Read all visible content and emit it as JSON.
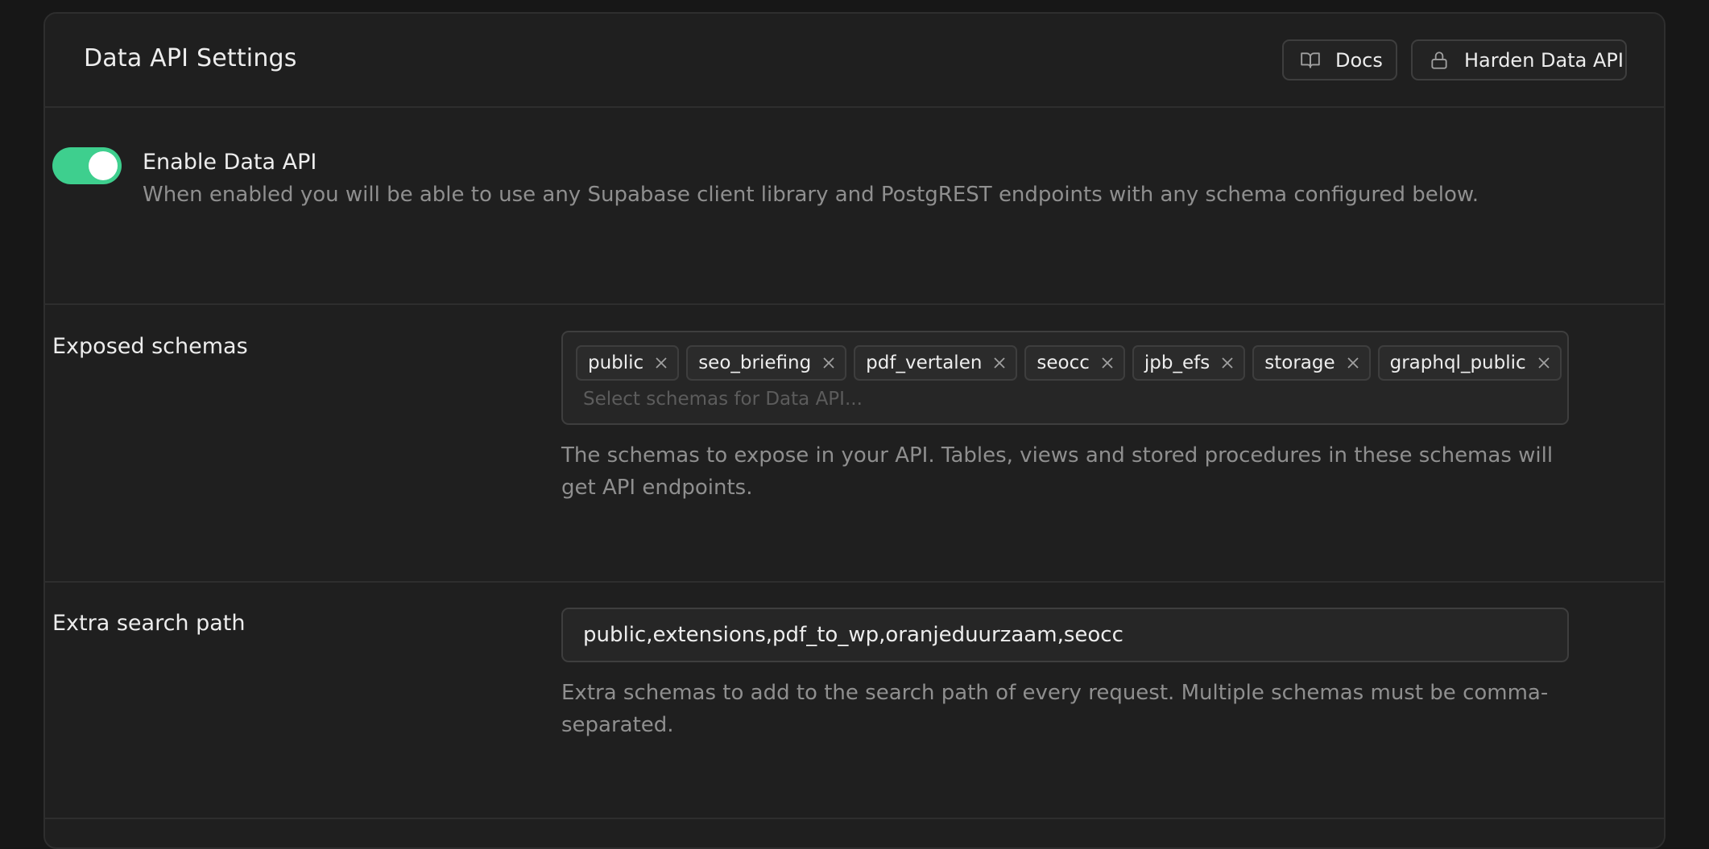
{
  "header": {
    "title": "Data API Settings",
    "docs_label": "Docs",
    "harden_label": "Harden Data API"
  },
  "enable": {
    "title": "Enable Data API",
    "description": "When enabled you will be able to use any Supabase client library and PostgREST endpoints with any schema configured below.",
    "enabled": true
  },
  "exposed_schemas": {
    "label": "Exposed schemas",
    "tags": [
      "public",
      "seo_briefing",
      "pdf_vertalen",
      "seocc",
      "jpb_efs",
      "storage",
      "graphql_public"
    ],
    "placeholder": "Select schemas for Data API...",
    "help": "The schemas to expose in your API. Tables, views and stored procedures in these schemas will get API endpoints."
  },
  "extra_search_path": {
    "label": "Extra search path",
    "value": "public,extensions,pdf_to_wp,oranjeduurzaam,seocc",
    "help": "Extra schemas to add to the search path of every request. Multiple schemas must be comma-separated."
  },
  "colors": {
    "background": "#171717",
    "panel": "#1f1f1f",
    "accent": "#3ecf8e",
    "border": "#2e2e2e",
    "muted_text": "#8f8f8f"
  }
}
